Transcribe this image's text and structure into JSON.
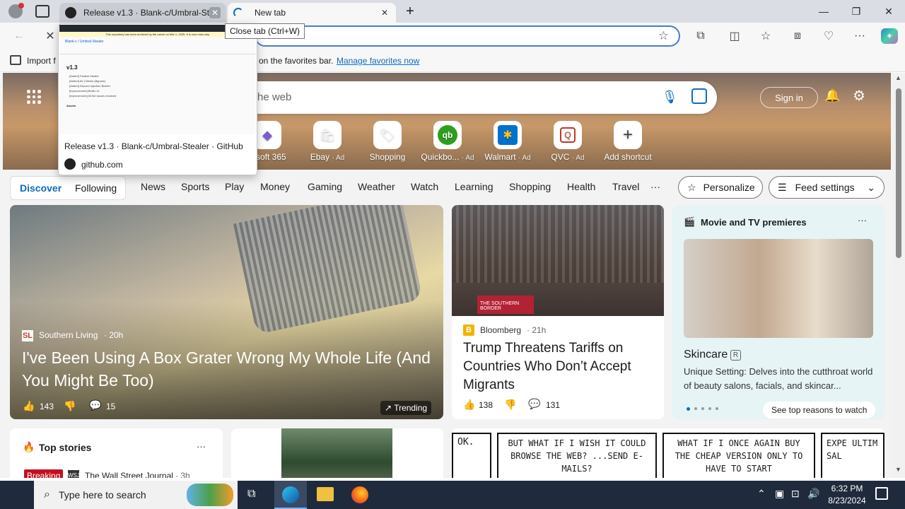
{
  "tabs": [
    {
      "title": "Release v1.3 · Blank-c/Umbral-St",
      "icon": "github-icon"
    },
    {
      "title": "New tab",
      "icon": "loading-icon"
    }
  ],
  "tooltip": "Close tab (Ctrl+W)",
  "preview": {
    "title": "Release v1.3 · Blank-c/Umbral-Stealer · GitHub",
    "domain": "github.com",
    "thumb_banner": "This repository has been archived by the owner on Mar 1, 2025. It is now read-only.",
    "thumb_repo": "Blank-c / Umbral-Stealer",
    "thumb_version": "v1.3",
    "thumb_bullets": [
      "[Added] Fastest Stealer",
      "[Added] AV Checks (Bypass)",
      "[Added] Discord Injection Builder",
      "[Improvement] Better UI",
      "[Improvement] All the issues resolved"
    ],
    "thumb_assets": "Assets"
  },
  "favbar": {
    "import_label": "Import f",
    "message": "on the favorites bar.",
    "link": "Manage favorites now"
  },
  "search": {
    "placeholder": "he web"
  },
  "header": {
    "signin": "Sign in"
  },
  "shortcuts": [
    {
      "label": "rosoft 365",
      "ad": ""
    },
    {
      "label": "Ebay",
      "ad": "· Ad"
    },
    {
      "label": "Shopping",
      "ad": ""
    },
    {
      "label": "Quickbo...",
      "ad": "· Ad"
    },
    {
      "label": "Walmart",
      "ad": "· Ad"
    },
    {
      "label": "QVC",
      "ad": "· Ad"
    },
    {
      "label": "Add shortcut",
      "ad": ""
    }
  ],
  "nav": {
    "discover": "Discover",
    "following": "Following",
    "items": [
      "News",
      "Sports",
      "Play",
      "Money",
      "Gaming",
      "Weather",
      "Watch",
      "Learning",
      "Shopping",
      "Health",
      "Travel"
    ],
    "more": "···",
    "personalize": "Personalize",
    "feed_settings": "Feed settings"
  },
  "main_story": {
    "source": "Southern Living",
    "age": "· 20h",
    "title": "I've Been Using A Box Grater Wrong My Whole Life (And You Might Be Too)",
    "likes": "143",
    "comments": "15",
    "trending": "Trending"
  },
  "trump_story": {
    "source": "Bloomberg",
    "age": "· 21h",
    "title": "Trump Threatens Tariffs on Countries Who Don’t Accept Migrants",
    "likes": "138",
    "comments": "131",
    "sign": "THE SOUTHERN BORDER"
  },
  "movie_card": {
    "header": "Movie and TV premieres",
    "title": "Skincare",
    "rating": "R",
    "desc": "Unique Setting: Delves into the cutthroat world of beauty salons, facials, and skincar...",
    "cta": "See top reasons to watch"
  },
  "top_stories": {
    "header": "Top stories",
    "badge": "Breaking",
    "source": "The Wall Street Journal",
    "age": "· 3h"
  },
  "comic": {
    "panel1": "OK.",
    "panel2": "BUT WHAT IF I WISH IT COULD BROWSE THE WEB? ...SEND E-MAILS?",
    "panel3": "WHAT IF I ONCE AGAIN BUY THE CHEAP VERSION ONLY TO HAVE TO START",
    "panel4": "EXPE ULTIM SAL"
  },
  "taskbar": {
    "search_placeholder": "Type here to search",
    "time": "6:32 PM",
    "date": "8/23/2024"
  },
  "colors": {
    "accent": "#0f6cbd",
    "breaking": "#c50f1f"
  }
}
